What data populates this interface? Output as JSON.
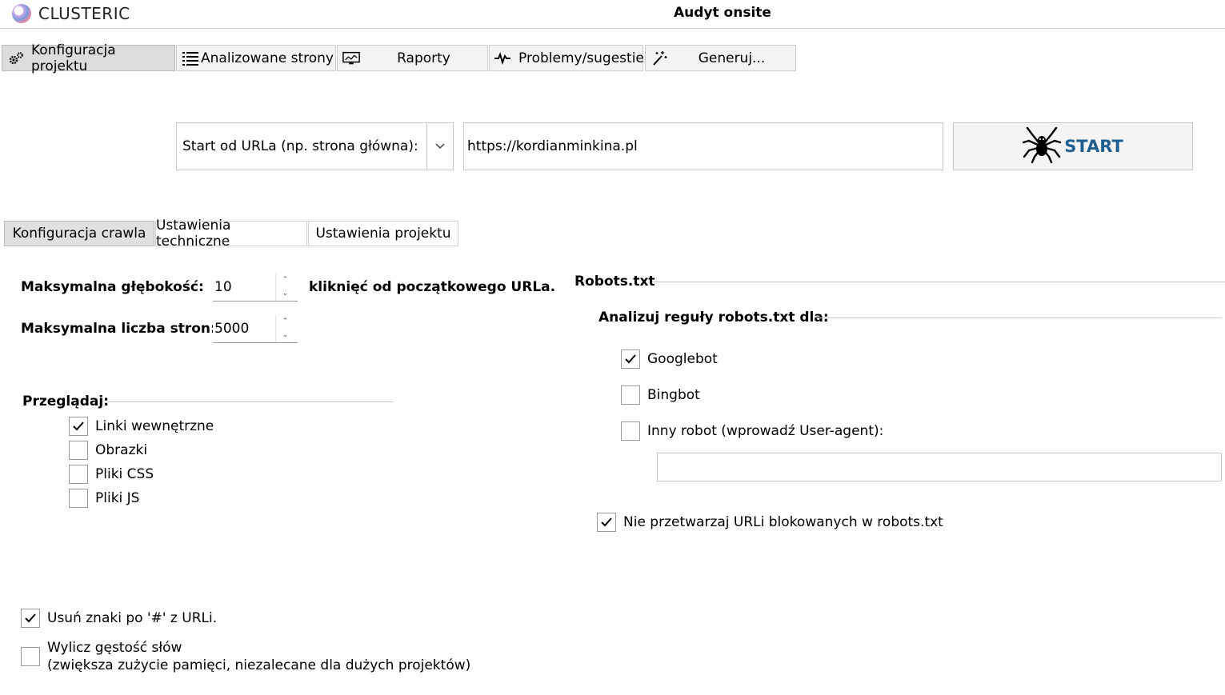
{
  "app": {
    "name": "CLUSTERIC",
    "window_title": "Audyt onsite"
  },
  "main_tabs": [
    {
      "label": "Konfiguracja projektu",
      "icon": "gears-icon",
      "active": true
    },
    {
      "label": "Analizowane strony",
      "icon": "list-icon",
      "active": false
    },
    {
      "label": "Raporty",
      "icon": "monitor-chart-icon",
      "active": false
    },
    {
      "label": "Problemy/sugestie",
      "icon": "pulse-icon",
      "active": false
    },
    {
      "label": "Generuj...",
      "icon": "magic-wand-icon",
      "active": false
    }
  ],
  "start": {
    "select_label": "Start od URLa (np. strona główna):",
    "url_value": "https://kordianminkina.pl",
    "button_label": "START",
    "button_color": "#1f5f8f"
  },
  "sub_tabs": [
    {
      "label": "Konfiguracja crawla",
      "active": true
    },
    {
      "label": "Ustawienia techniczne",
      "active": false
    },
    {
      "label": "Ustawienia projektu",
      "active": false
    }
  ],
  "crawl": {
    "max_depth_label": "Maksymalna głębokość:",
    "max_depth_value": "10",
    "max_depth_suffix": "kliknięć od początkowego URLa.",
    "max_pages_label": "Maksymalna liczba stron:",
    "max_pages_value": "5000"
  },
  "browse": {
    "title": "Przeglądaj:",
    "items": [
      {
        "label": "Linki wewnętrzne",
        "checked": true
      },
      {
        "label": "Obrazki",
        "checked": false
      },
      {
        "label": "Pliki CSS",
        "checked": false
      },
      {
        "label": "Pliki JS",
        "checked": false
      }
    ]
  },
  "robots": {
    "title": "Robots.txt",
    "rules_title": "Analizuj reguły robots.txt dla:",
    "bots": [
      {
        "label": "Googlebot",
        "checked": true
      },
      {
        "label": "Bingbot",
        "checked": false
      },
      {
        "label": "Inny robot (wprowadź User-agent):",
        "checked": false
      }
    ],
    "user_agent_value": "",
    "skip_blocked": {
      "label": "Nie przetwarzaj URLi blokowanych w robots.txt",
      "checked": true
    }
  },
  "options": {
    "remove_hash": {
      "label": "Usuń znaki po '#' z URLi.",
      "checked": true
    },
    "word_density": {
      "label_line1": "Wylicz gęstość słów",
      "label_line2": "(zwiększa zużycie pamięci, niezalecane dla dużych projektów)",
      "checked": false
    }
  }
}
